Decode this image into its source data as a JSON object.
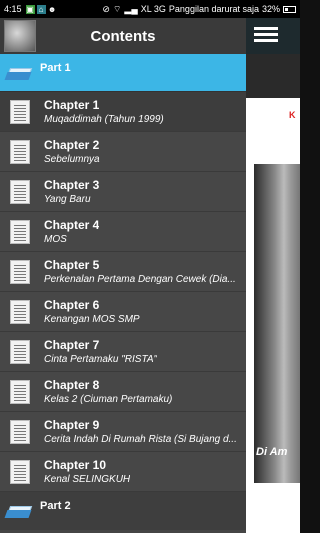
{
  "status": {
    "time": "4:15",
    "network": "XL 3G",
    "emergency": "Panggilan darurat saja",
    "battery": "32%"
  },
  "drawer": {
    "title": "Contents",
    "parts": [
      "Part 1",
      "Part 2"
    ],
    "chapters": [
      {
        "title": "Chapter 1",
        "subtitle": "Muqaddimah (Tahun 1999)"
      },
      {
        "title": "Chapter 2",
        "subtitle": "Sebelumnya"
      },
      {
        "title": "Chapter 3",
        "subtitle": "Yang Baru"
      },
      {
        "title": "Chapter 4",
        "subtitle": "MOS"
      },
      {
        "title": "Chapter 5",
        "subtitle": "Perkenalan Pertama Dengan Cewek (Dia..."
      },
      {
        "title": "Chapter 6",
        "subtitle": "Kenangan MOS SMP"
      },
      {
        "title": "Chapter 7",
        "subtitle": "Cinta Pertamaku \"RISTA\""
      },
      {
        "title": "Chapter 8",
        "subtitle": "Kelas 2 (Ciuman Pertamaku)"
      },
      {
        "title": "Chapter 9",
        "subtitle": "Cerita Indah Di Rumah Rista (Si Bujang d..."
      },
      {
        "title": "Chapter 10",
        "subtitle": "Kenal SELINGKUH"
      }
    ]
  },
  "background": {
    "red_text": "K",
    "caption": "Di Am"
  },
  "colors": {
    "accent": "#3cb6e6",
    "drawer_bg": "#454545"
  }
}
